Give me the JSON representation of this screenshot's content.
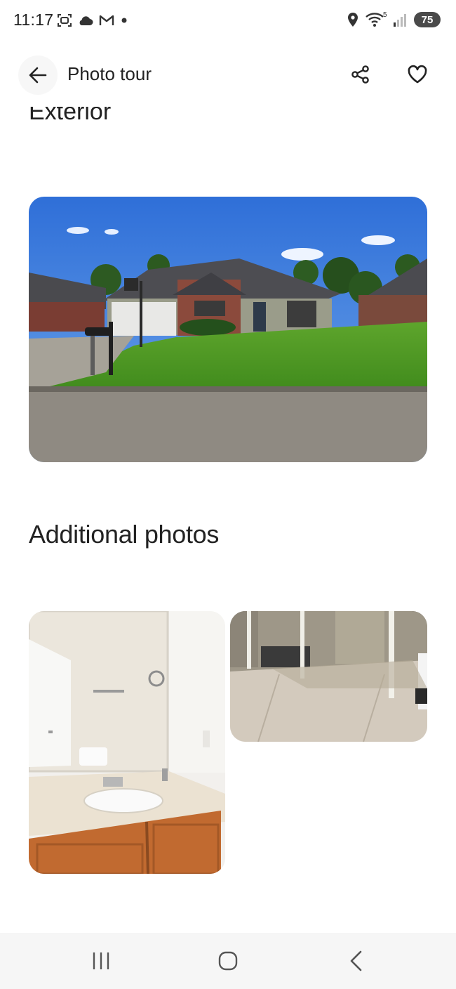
{
  "status_bar": {
    "time": "11:17",
    "battery": "75",
    "wifi_badge": "5",
    "left_icons": [
      "screenshot-icon",
      "cloud-icon",
      "gmail-icon",
      "dot-icon"
    ],
    "right_icons": [
      "location-icon",
      "wifi-icon",
      "signal-icon"
    ]
  },
  "header": {
    "title": "Photo tour",
    "back_icon": "arrow-left-icon",
    "share_icon": "share-icon",
    "save_icon": "heart-icon"
  },
  "sections": {
    "exterior_heading": "Exterior",
    "additional_heading": "Additional photos"
  },
  "photos": {
    "exterior": "exterior-house-photo",
    "bathroom": "bathroom-vanity-photo",
    "patio": "covered-patio-photo"
  },
  "nav_bar": {
    "icons": [
      "recent-apps-icon",
      "home-icon",
      "back-icon"
    ]
  },
  "colors": {
    "text": "#222222",
    "nav_background": "#f6f6f6"
  }
}
